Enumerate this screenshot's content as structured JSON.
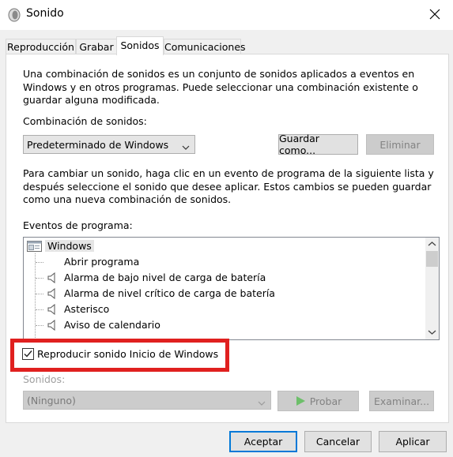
{
  "window": {
    "title": "Sonido",
    "icon": "speaker-icon",
    "close_icon": "close-icon"
  },
  "tabs": [
    {
      "label": "Reproducción",
      "active": false
    },
    {
      "label": "Grabar",
      "active": false
    },
    {
      "label": "Sonidos",
      "active": true
    },
    {
      "label": "Comunicaciones",
      "active": false
    }
  ],
  "sounds": {
    "intro": "Una combinación de sonidos es un conjunto de sonidos aplicados a eventos en\nWindows y en otros programas. Puede seleccionar una combinación existente o\nguardar alguna modificada.",
    "scheme_label": "Combinación de sonidos:",
    "scheme_value": "Predeterminado de Windows",
    "save_as_label": "Guardar como...",
    "delete_label": "Eliminar",
    "instructions": "Para cambiar un sonido, haga clic en un evento de programa de la siguiente lista y\ndespués seleccione el sonido que desee aplicar. Estos cambios se pueden guardar\ncomo una nueva combinación de sonidos.",
    "events_label": "Eventos de programa:",
    "events": {
      "group": "Windows",
      "items": [
        {
          "label": "Abrir programa",
          "has_sound": false
        },
        {
          "label": "Alarma de bajo nivel de carga de batería",
          "has_sound": true
        },
        {
          "label": "Alarma de nivel crítico de carga de batería",
          "has_sound": true
        },
        {
          "label": "Asterisco",
          "has_sound": true
        },
        {
          "label": "Aviso de calendario",
          "has_sound": true
        }
      ]
    },
    "startup_checkbox_label": "Reproducir sonido Inicio de Windows",
    "startup_checked": true,
    "sounds_label": "Sonidos:",
    "sounds_value": "(Ninguno)",
    "test_label": "Probar",
    "browse_label": "Examinar..."
  },
  "footer": {
    "accept_label": "Aceptar",
    "cancel_label": "Cancelar",
    "apply_label": "Aplicar"
  },
  "colors": {
    "highlight_border": "#e0201f",
    "default_button_border": "#0078d7",
    "play_icon": "#6dbf6a"
  }
}
